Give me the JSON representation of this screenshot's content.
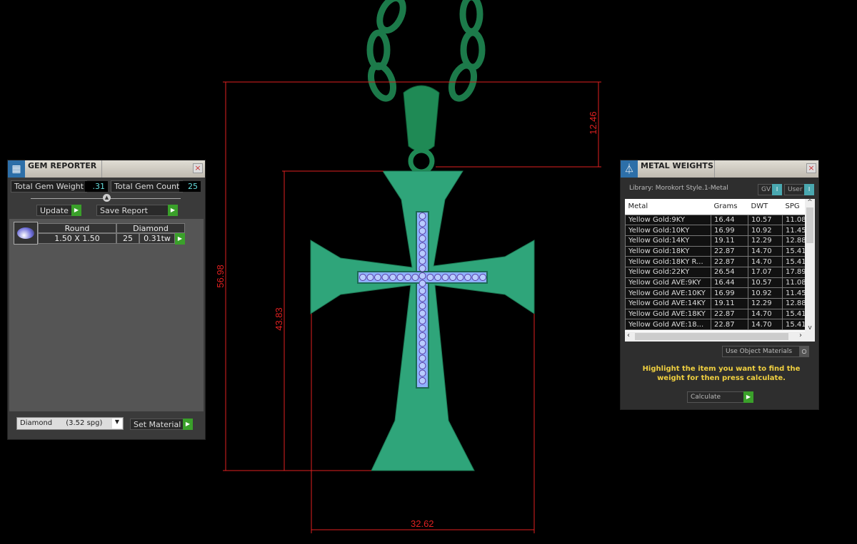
{
  "dimensions": {
    "overall_height": "56.98",
    "body_height": "43.83",
    "bail_height": "12.46",
    "width": "32.62"
  },
  "colors": {
    "metal": "#2fa57a",
    "gems": "#8fb0ff",
    "dimension_lines": "#e02020",
    "accent_button": "#3aa02a",
    "hint_text": "#f0d040"
  },
  "gem_reporter": {
    "title": "GEM REPORTER",
    "icon": "gem-reporter-icon",
    "total_weight_label": "Total Gem Weight",
    "total_weight": ".31",
    "total_count_label": "Total Gem Count",
    "total_count": "25",
    "update_label": "Update",
    "save_report_label": "Save Report",
    "gems": [
      {
        "shape": "Round",
        "material": "Diamond",
        "size": "1.50 X 1.50",
        "count": "25",
        "weight": "0.31tw"
      }
    ],
    "material_select": "Diamond      (3.52 spg)",
    "set_material_label": "Set Material"
  },
  "metal_weights": {
    "title": "METAL WEIGHTS",
    "library": "Library: Morokort Style.1-Metal",
    "gv_label": "GV",
    "user_label": "User",
    "columns": [
      "Metal",
      "Grams",
      "DWT",
      "SPG"
    ],
    "rows": [
      [
        "Yellow Gold:9KY",
        "16.44",
        "10.57",
        "11.08"
      ],
      [
        "Yellow Gold:10KY",
        "16.99",
        "10.92",
        "11.45"
      ],
      [
        "Yellow Gold:14KY",
        "19.11",
        "12.29",
        "12.88"
      ],
      [
        "Yellow Gold:18KY",
        "22.87",
        "14.70",
        "15.41"
      ],
      [
        "Yellow Gold:18KY R...",
        "22.87",
        "14.70",
        "15.41"
      ],
      [
        "Yellow Gold:22KY",
        "26.54",
        "17.07",
        "17.89"
      ],
      [
        "Yellow Gold AVE:9KY",
        "16.44",
        "10.57",
        "11.08"
      ],
      [
        "Yellow Gold AVE:10KY",
        "16.99",
        "10.92",
        "11.45"
      ],
      [
        "Yellow Gold AVE:14KY",
        "19.11",
        "12.29",
        "12.88"
      ],
      [
        "Yellow Gold AVE:18KY",
        "22.87",
        "14.70",
        "15.41"
      ],
      [
        "Yellow Gold AVE:18...",
        "22.87",
        "14.70",
        "15.41"
      ]
    ],
    "use_object_materials": "Use Object Materials",
    "hint": "Highlight the item you want to find the weight for then press calculate.",
    "calculate_label": "Calculate"
  }
}
